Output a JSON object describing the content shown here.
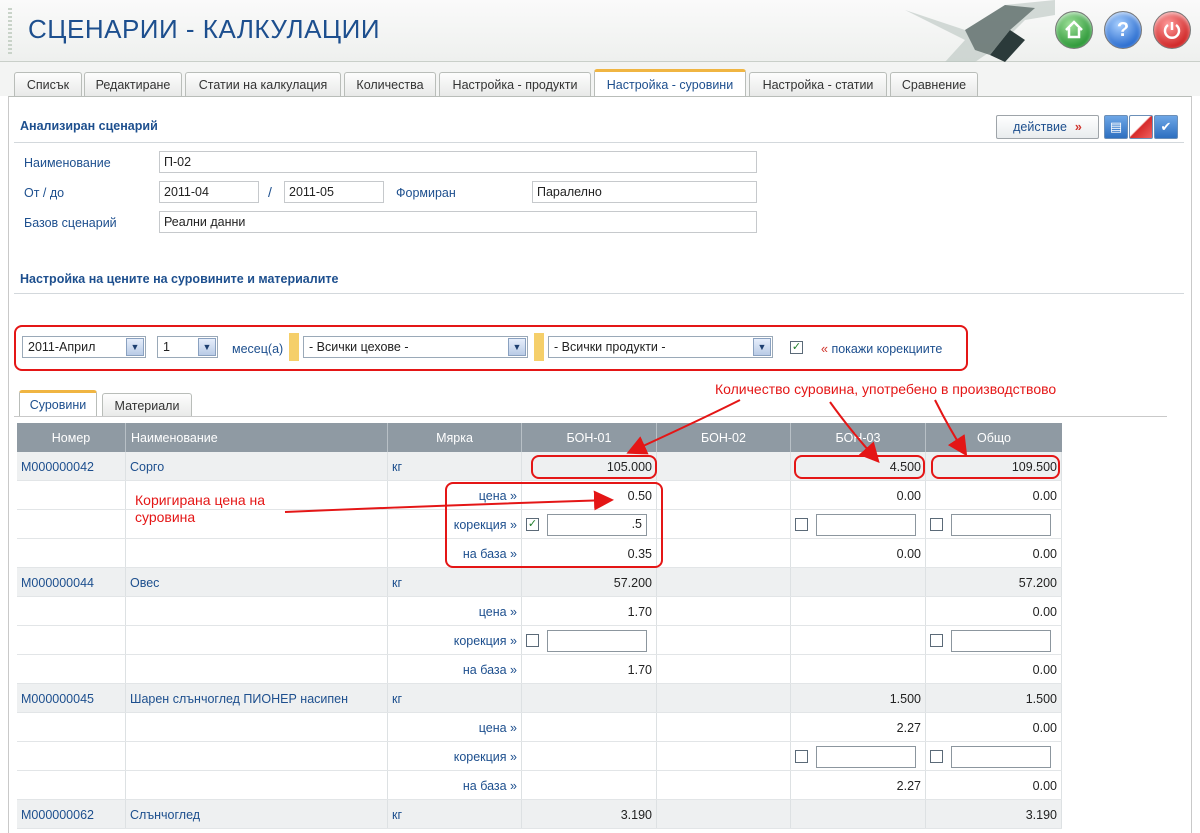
{
  "header": {
    "title": "СЦЕНАРИИ - КАЛКУЛАЦИИ",
    "buttons": [
      {
        "icon": "home-icon",
        "color": "#2f9a3a"
      },
      {
        "icon": "help-icon",
        "label": "?",
        "color": "#2d6fd0"
      },
      {
        "icon": "power-icon",
        "color": "#d02828"
      }
    ]
  },
  "tabs": [
    {
      "label": "Списък"
    },
    {
      "label": "Редактиране"
    },
    {
      "label": "Статии на калкулация"
    },
    {
      "label": "Количества"
    },
    {
      "label": "Настройка - продукти"
    },
    {
      "label": "Настройка - суровини",
      "active": true
    },
    {
      "label": "Настройка - статии"
    },
    {
      "label": "Сравнение"
    }
  ],
  "scenario": {
    "section_title": "Анализиран сценарий",
    "action_label": "действие",
    "action_arrow": "»",
    "name_label": "Наименование",
    "name_value": "П-02",
    "period_label": "От / до",
    "from_value": "2011-04",
    "slash": "/",
    "to_value": "2011-05",
    "formed_label": "Формиран",
    "formed_value": "Паралелно",
    "base_label": "Базов сценарий",
    "base_value": "Реални данни"
  },
  "prices_section": {
    "title": "Настройка на цените на суровините и материалите"
  },
  "filters": {
    "month": "2011-Април",
    "count": "1",
    "count_unit": "месец(а)",
    "workshop": "- Всички цехове -",
    "product": "- Всички продукти -",
    "show_corrections_checked": true,
    "show_corrections_label": "покажи корекциите",
    "show_corrections_arrow": "«"
  },
  "subtabs": [
    {
      "label": "Суровини",
      "active": true
    },
    {
      "label": "Материали"
    }
  ],
  "table": {
    "headers": [
      "Номер",
      "Наименование",
      "Мярка",
      "БОН-01",
      "БОН-02",
      "БОН-03",
      "Общо"
    ],
    "sub_labels": {
      "price": "цена »",
      "correction": "корекция »",
      "base": "на база »"
    },
    "items": [
      {
        "number": "M000000042",
        "name": "Сорго",
        "unit": "кг",
        "qty": [
          "105.000",
          "",
          "4.500",
          "109.500"
        ],
        "price": [
          "0.50",
          "",
          "0.00",
          "0.00"
        ],
        "correction": [
          {
            "checked": true,
            "value": ".5"
          },
          null,
          {
            "checked": false,
            "value": ""
          },
          {
            "checked": false,
            "value": ""
          }
        ],
        "base": [
          "0.35",
          "",
          "0.00",
          "0.00"
        ]
      },
      {
        "number": "M000000044",
        "name": "Овес",
        "unit": "кг",
        "qty": [
          "57.200",
          "",
          "",
          "57.200"
        ],
        "price": [
          "1.70",
          "",
          "",
          "0.00"
        ],
        "correction": [
          {
            "checked": false,
            "value": ""
          },
          null,
          null,
          {
            "checked": false,
            "value": ""
          }
        ],
        "base": [
          "1.70",
          "",
          "",
          "0.00"
        ]
      },
      {
        "number": "M000000045",
        "name": "Шарен слънчоглед ПИОНЕР насипен",
        "unit": "кг",
        "qty": [
          "",
          "",
          "1.500",
          "1.500"
        ],
        "price": [
          "",
          "",
          "2.27",
          "0.00"
        ],
        "correction": [
          null,
          null,
          {
            "checked": false,
            "value": ""
          },
          {
            "checked": false,
            "value": ""
          }
        ],
        "base": [
          "",
          "",
          "2.27",
          "0.00"
        ]
      },
      {
        "number": "M000000062",
        "name": "Слънчоглед",
        "unit": "кг",
        "qty": [
          "3.190",
          "",
          "",
          "3.190"
        ]
      }
    ]
  },
  "annotations": {
    "quantity_note": "Количество суровина, употребено в производствово",
    "price_note": "Коригирана цена на суровина",
    "color": "#e41616"
  }
}
